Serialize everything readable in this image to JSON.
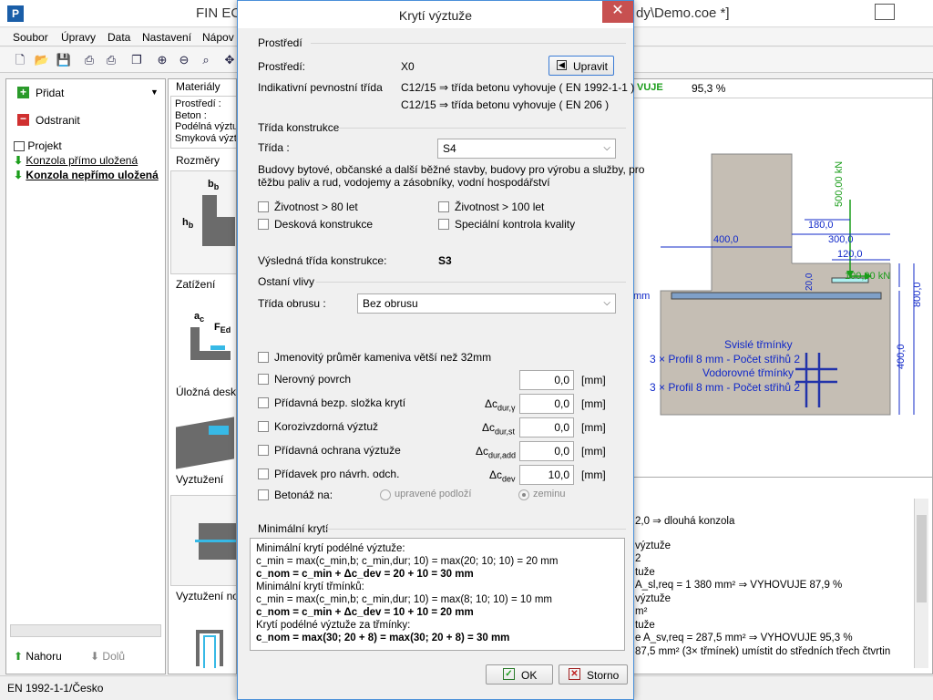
{
  "app": {
    "title": "FIN EC",
    "title_right": "dy\\Demo.coe *]",
    "menu": [
      "Soubor",
      "Úpravy",
      "Data",
      "Nastavení",
      "Nápov"
    ],
    "left_panel": {
      "add_label": "Přidat",
      "remove_label": "Odstranit",
      "tree": [
        "Projekt",
        "Konzola přímo uložená",
        "Konzola nepřímo uložená"
      ],
      "up_label": "Nahoru",
      "down_label": "Dolů"
    },
    "middle_panel": {
      "materials": "Materiály",
      "materials_lines": [
        "Prostředí :",
        "Beton :",
        "Podélná výztu",
        "Smyková výzt"
      ],
      "dimensions": "Rozměry",
      "loads": "Zatížení",
      "bearing_plate": "Úložná deska",
      "reinforcement": "Vyztužení",
      "support_reinforcement": "Vyztužení nos"
    },
    "right_panel": {
      "status_word": "VUJE",
      "status_pct": "95,3 %",
      "drawing": {
        "load_vertical": "500,00 kN",
        "load_horizontal": "100,00 kN",
        "dim_400": "400,0",
        "dim_180": "180,0",
        "dim_300": "300,0",
        "dim_120": "120,0",
        "dim_20": "20,0",
        "dim_800": "800,0",
        "dim_400b": "400,0",
        "mm": "mm",
        "stirrups_1": "Svislé třmínky",
        "stirrups_2": "3 × Profil 8 mm - Počet střihů 2",
        "stirrups_3": "Vodorovné třmínky",
        "stirrups_4": "3 × Profil 8 mm - Počet střihů 2"
      },
      "results": [
        "2,0 ⇒ dlouhá konzola",
        "výztuže",
        "2",
        "tuže",
        "A_sl,req = 1 380 mm² ⇒ VYHOVUJE 87,9 %",
        "výztuže",
        "m²",
        "tuže",
        "e A_sv,req = 287,5 mm² ⇒ VYHOVUJE 95,3 %",
        "87,5 mm² (3× třmínek) umístit do středních třech čtvrtin"
      ]
    },
    "statusbar": "EN 1992-1-1/Česko"
  },
  "dialog": {
    "title": "Krytí výztuže",
    "env_section": "Prostředí",
    "env_label": "Prostředí:",
    "env_value": "X0",
    "edit_button": "Upravit",
    "indicative_label": "Indikativní pevnostní třída",
    "indicative_line1": "C12/15 ⇒ třída betonu vyhovuje ( EN 1992-1-1 )",
    "indicative_line2": "C12/15 ⇒ třída betonu vyhovuje ( EN 206 )",
    "class_section": "Třída konstrukce",
    "class_label": "Třída :",
    "class_value": "S4",
    "class_desc_1": "Budovy bytové, občanské a další běžné stavby, budovy pro výrobu a služby, pro",
    "class_desc_2": "těžbu paliv a rud, vodojemy a zásobníky, vodní hospodářství",
    "cb_life80": "Životnost > 80 let",
    "cb_life100": "Životnost > 100 let",
    "cb_slab": "Desková konstrukce",
    "cb_quality": "Speciální kontrola kvality",
    "result_class_label": "Výsledná třída konstrukce:",
    "result_class_value": "S3",
    "other_section": "Ostaní vlivy",
    "abrasion_label": "Třída obrusu :",
    "abrasion_value": "Bez obrusu",
    "cb_aggregate": "Jmenovitý průměr kameniva větší než 32mm",
    "cb_uneven": "Nerovný povrch",
    "cb_additional": "Přídavná bezp. složka krytí",
    "cb_stainless": "Korozivzdorná výztuž",
    "cb_protection": "Přídavná ochrana výztuže",
    "cb_deviation": "Přídavek pro návrh. odch.",
    "cb_cast": "Betonáž na:",
    "sym_dur_y": "Δc",
    "sub_dur_y": "dur,γ",
    "sym_dur_st": "Δc",
    "sub_dur_st": "dur,st",
    "sym_dur_add": "Δc",
    "sub_dur_add": "dur,add",
    "sym_dev": "Δc",
    "sub_dev": "dev",
    "val_uneven": "0,0",
    "val_additional": "0,0",
    "val_stainless": "0,0",
    "val_protection": "0,0",
    "val_deviation": "10,0",
    "unit_mm": "[mm]",
    "radio_prepared": "upravené podloží",
    "radio_ground": "zeminu",
    "min_cover_section": "Minimální krytí",
    "min_text": [
      "Minimální krytí podélné výztuže:",
      "c_min = max(c_min,b; c_min,dur; 10) = max(20; 10; 10) = 20 mm",
      "c_nom = c_min + Δc_dev = 20 + 10 = 30 mm",
      "Minimální krytí třmínků:",
      "c_min = max(c_min,b; c_min,dur; 10) = max(8; 10; 10) = 10 mm",
      "c_nom = c_min + Δc_dev = 10 + 10 = 20 mm",
      "Krytí podélné výztuže za třmínky:",
      "c_nom = max(30; 20 + 8) = max(30; 20 + 8) = 30 mm"
    ],
    "ok_label": "OK",
    "cancel_label": "Storno"
  }
}
